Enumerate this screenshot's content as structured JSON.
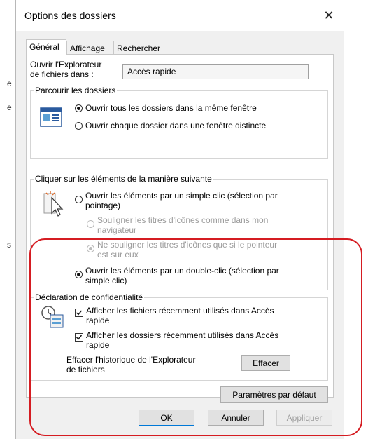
{
  "background": {
    "left_letters": [
      "e",
      "e",
      "s"
    ]
  },
  "dialog": {
    "title": "Options des dossiers",
    "close_icon": "close-icon",
    "tabs": [
      {
        "label": "Général",
        "active": true
      },
      {
        "label": "Affichage",
        "active": false
      },
      {
        "label": "Rechercher",
        "active": false
      }
    ],
    "open_explorer": {
      "label_line1": "Ouvrir l'Explorateur",
      "label_line2": "de fichiers dans :",
      "selected": "Accès rapide"
    },
    "browse": {
      "legend": "Parcourir les dossiers",
      "icon": "folder-window-icon",
      "option_same_line": "Ouvrir tous les dossiers dans la même fenêtre",
      "option_new_line": "Ouvrir chaque dossier dans une fenêtre distincte"
    },
    "click": {
      "legend": "Cliquer sur les éléments de la manière suivante",
      "icon": "pointer-click-icon",
      "single_line1": "Ouvrir les éléments par un simple clic (sélection par",
      "single_line2": "pointage)",
      "underline_browser_line1": "Souligner les titres d'icônes comme dans mon",
      "underline_browser_line2": "navigateur",
      "underline_hover_line1": "Ne souligner les titres d'icônes que si le pointeur",
      "underline_hover_line2": "est sur eux",
      "double_line1": "Ouvrir les éléments par un double-clic (sélection par",
      "double_line2": "simple clic)"
    },
    "privacy": {
      "legend": "Déclaration de confidentialité",
      "icon": "privacy-recent-icon",
      "recent_files_line1": "Afficher les fichiers récemment utilisés dans Accès",
      "recent_files_line2": "rapide",
      "recent_folders_line1": "Afficher les dossiers récemment utilisés dans Accès",
      "recent_folders_line2": "rapide",
      "clear_label_line1": "Effacer l'historique de l'Explorateur",
      "clear_label_line2": "de fichiers",
      "clear_button": "Effacer"
    },
    "restore_defaults": "Paramètres par défaut",
    "ok": "OK",
    "cancel": "Annuler",
    "apply": "Appliquer"
  },
  "colors": {
    "annotation": "#d51c22",
    "default_button_border": "#0078d7"
  }
}
